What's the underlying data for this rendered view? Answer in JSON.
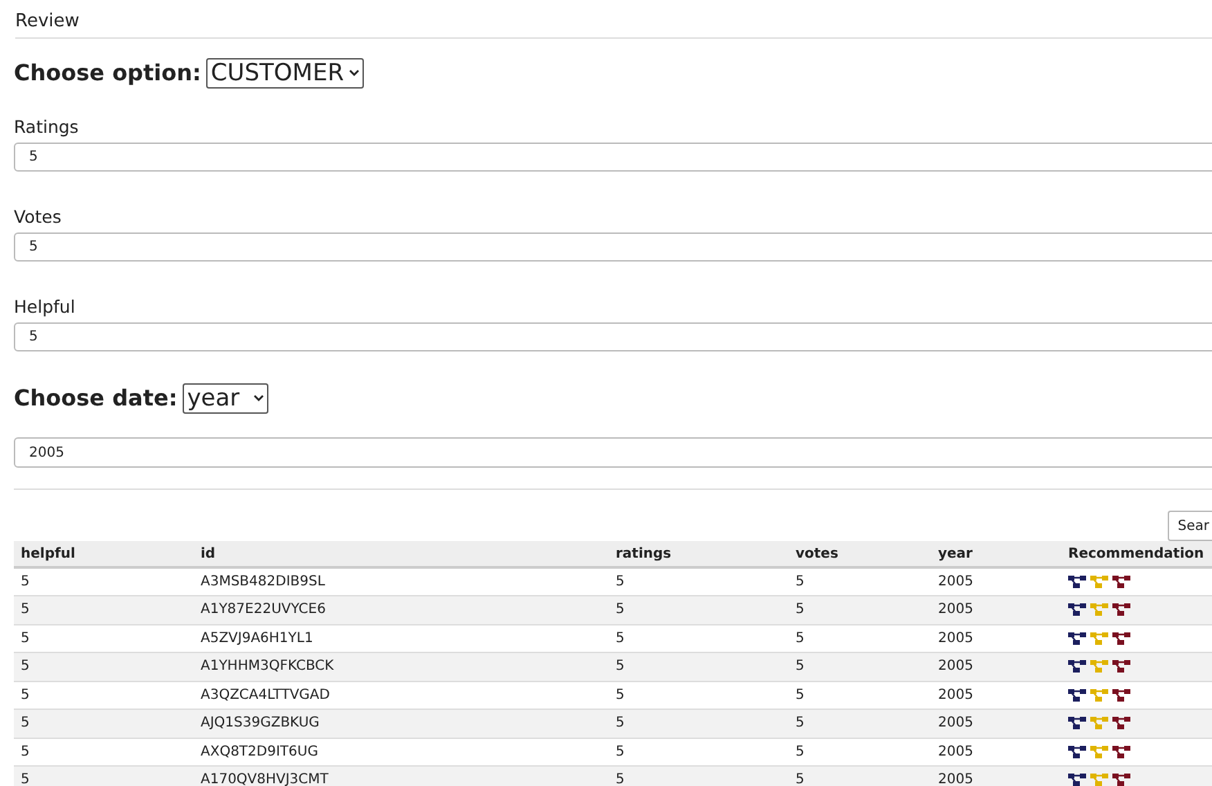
{
  "header": {
    "title": "Review"
  },
  "option": {
    "label": "Choose option:",
    "value": "CUSTOMER"
  },
  "fields": [
    {
      "label": "Ratings",
      "value": "5"
    },
    {
      "label": "Votes",
      "value": "5"
    },
    {
      "label": "Helpful",
      "value": "5"
    }
  ],
  "date": {
    "label": "Choose date:",
    "value": "year",
    "field_value": "2005"
  },
  "search_button": "Sear",
  "recommendation_icons": [
    {
      "color": "#1c1f5e"
    },
    {
      "color": "#e0b400"
    },
    {
      "color": "#7a1020"
    }
  ],
  "table": {
    "columns": [
      "helpful",
      "id",
      "ratings",
      "votes",
      "year",
      "Recommendation"
    ],
    "rows": [
      [
        "5",
        "A3MSB482DIB9SL",
        "5",
        "5",
        "2005"
      ],
      [
        "5",
        "A1Y87E22UVYCE6",
        "5",
        "5",
        "2005"
      ],
      [
        "5",
        "A5ZVJ9A6H1YL1",
        "5",
        "5",
        "2005"
      ],
      [
        "5",
        "A1YHHM3QFKCBCK",
        "5",
        "5",
        "2005"
      ],
      [
        "5",
        "A3QZCA4LTTVGAD",
        "5",
        "5",
        "2005"
      ],
      [
        "5",
        "AJQ1S39GZBKUG",
        "5",
        "5",
        "2005"
      ],
      [
        "5",
        "AXQ8T2D9IT6UG",
        "5",
        "5",
        "2005"
      ],
      [
        "5",
        "A170QV8HVJ3CMT",
        "5",
        "5",
        "2005"
      ]
    ]
  }
}
